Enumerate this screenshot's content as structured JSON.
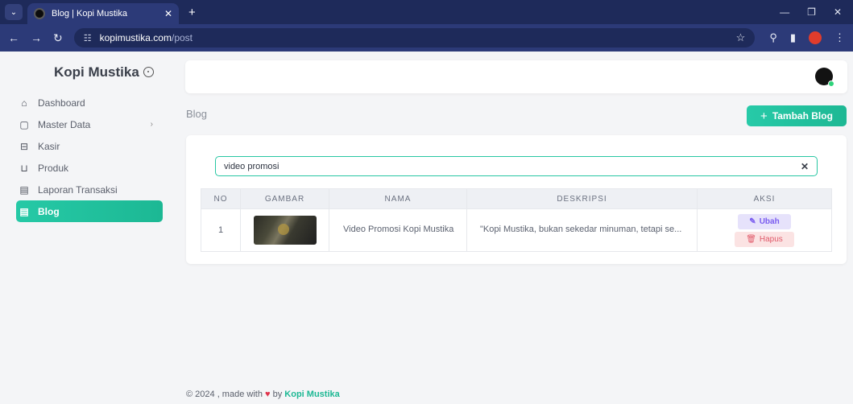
{
  "browser": {
    "tab_title": "Blog | Kopi Mustika",
    "url_host": "kopimustika.com",
    "url_path": "/post"
  },
  "sidebar": {
    "brand": "Kopi Mustika",
    "items": [
      {
        "label": "Dashboard",
        "icon": "home-icon"
      },
      {
        "label": "Master Data",
        "icon": "square-icon"
      },
      {
        "label": "Kasir",
        "icon": "cashier-icon"
      },
      {
        "label": "Produk",
        "icon": "cart-icon"
      },
      {
        "label": "Laporan Transaksi",
        "icon": "report-icon"
      },
      {
        "label": "Blog",
        "icon": "blog-icon"
      }
    ]
  },
  "header": {
    "page_title": "Blog",
    "add_button": "Tambah Blog"
  },
  "search": {
    "value": "video promosi"
  },
  "table": {
    "columns": [
      "NO",
      "GAMBAR",
      "NAMA",
      "DESKRIPSI",
      "AKSI"
    ],
    "rows": [
      {
        "no": "1",
        "name": "Video Promosi Kopi Mustika",
        "description": "\"Kopi Mustika, bukan sekedar minuman, tetapi se...",
        "edit_label": "Ubah",
        "delete_label": "Hapus"
      }
    ]
  },
  "footer": {
    "prefix": "© 2024 , made with",
    "by": "by",
    "brand": "Kopi Mustika"
  },
  "colors": {
    "accent": "#1db894",
    "browser_frame": "#1e2a5a",
    "edit": "#7a5cf0",
    "delete": "#e05a6a"
  }
}
